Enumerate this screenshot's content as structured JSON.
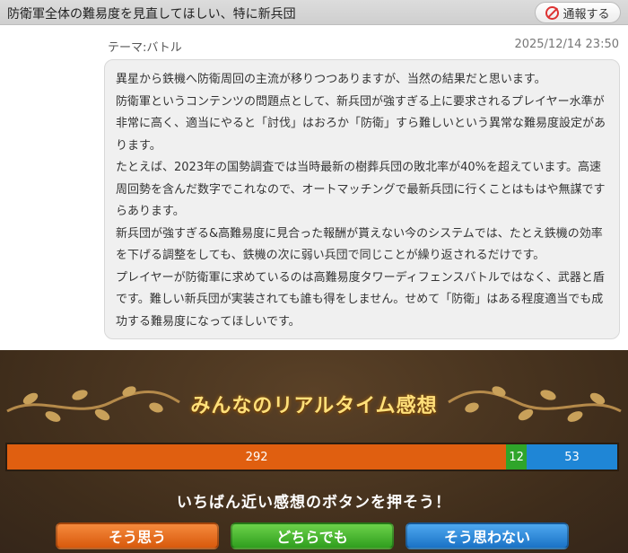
{
  "header": {
    "title": "防衛軍全体の難易度を見直してほしい、特に新兵団",
    "report_label": "通報する"
  },
  "post": {
    "theme": "テーマ:バトル",
    "timestamp": "2025/12/14 23:50",
    "paragraphs": [
      "異星から鉄機へ防衛周回の主流が移りつつありますが、当然の結果だと思います。",
      "防衛軍というコンテンツの問題点として、新兵団が強すぎる上に要求されるプレイヤー水準が非常に高く、適当にやると「討伐」はおろか「防衛」すら難しいという異常な難易度設定があります。",
      "たとえば、2023年の国勢調査では当時最新の樹葬兵団の敗北率が40%を超えています。高速周回勢を含んだ数字でこれなので、オートマッチングで最新兵団に行くことはもはや無謀ですらあります。",
      "新兵団が強すぎる&高難易度に見合った報酬が貰えない今のシステムでは、たとえ鉄機の効率を下げる調整をしても、鉄機の次に弱い兵団で同じことが繰り返されるだけです。",
      "プレイヤーが防衛軍に求めているのは高難易度タワーディフェンスバトルではなく、武器と盾です。難しい新兵団が実装されても誰も得をしません。せめて「防衛」はある程度適当でも成功する難易度になってほしいです。"
    ]
  },
  "panel": {
    "title": "みんなのリアルタイム感想",
    "prompt": "いちばん近い感想のボタンを押そう！"
  },
  "votes": {
    "agree": 292,
    "neutral": 12,
    "disagree": 53
  },
  "buttons": {
    "agree": "そう思う",
    "neutral": "どちらでも",
    "disagree": "そう思わない"
  },
  "colors": {
    "agree": "#e05f10",
    "neutral": "#2fa52a",
    "disagree": "#1f86d6",
    "title_gold": "#ffe07a"
  },
  "icons": {
    "report": "ban-icon",
    "ornament": "vine-icon"
  }
}
